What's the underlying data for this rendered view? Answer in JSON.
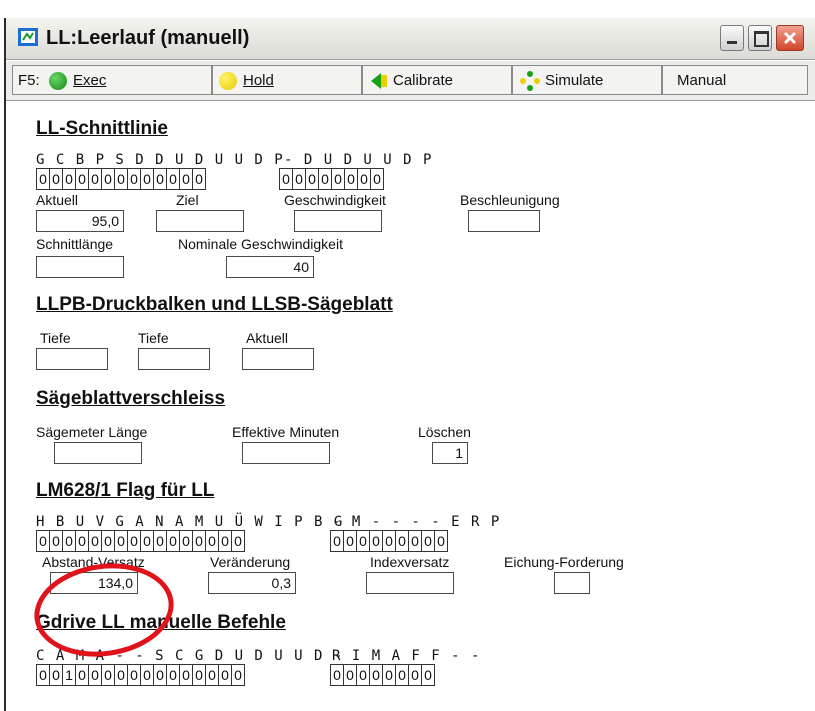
{
  "window": {
    "title": "LL:Leerlauf (manuell)",
    "titlebar_color": "#dcdcd6",
    "close_color": "#d2462a"
  },
  "toolbar": {
    "fkey": "F5:",
    "exec_label": "Exec",
    "hold_label": "Hold",
    "calibrate_label": "Calibrate",
    "simulate_label": "Simulate",
    "manual_label": "Manual"
  },
  "ll_schnittlinie": {
    "title": "LL-Schnittlinie",
    "flags_a": "G C B P S D D U D U U D P",
    "flags_b": "- D U D U U D P",
    "bits_a": [
      "0",
      "0",
      "0",
      "0",
      "0",
      "0",
      "0",
      "0",
      "0",
      "0",
      "0",
      "0",
      "0"
    ],
    "bits_b": [
      "0",
      "0",
      "0",
      "0",
      "0",
      "0",
      "0",
      "0"
    ],
    "aktuell_label": "Aktuell",
    "aktuell_value": "95,0",
    "ziel_label": "Ziel",
    "ziel_value": "",
    "geschwindigkeit_label": "Geschwindigkeit",
    "geschwindigkeit_value": "",
    "beschleunigung_label": "Beschleunigung",
    "beschleunigung_value": "",
    "schnittlaenge_label": "Schnittlänge",
    "schnittlaenge_value": "",
    "nominale_label": "Nominale Geschwindigkeit",
    "nominale_value": "40"
  },
  "llpb": {
    "title": "LLPB-Druckbalken und LLSB-Sägeblatt",
    "tiefe1_label": "Tiefe",
    "tiefe2_label": "Tiefe",
    "aktuell_label": "Aktuell",
    "tiefe1_value": "",
    "tiefe2_value": "",
    "aktuell_value": ""
  },
  "saegeblatt": {
    "title": "Sägeblattverschleiss",
    "saegemeter_label": "Sägemeter Länge",
    "saegemeter_value": "",
    "effektive_label": "Effektive Minuten",
    "effektive_value": "",
    "loeschen_label": "Löschen",
    "loeschen_value": "1"
  },
  "lm628": {
    "title": "LM628/1 Flag für LL",
    "flags_a": "H B U V G A N A M U Ü W I P B G",
    "flags_b": "- M - - - - E R P",
    "bits_a": [
      "0",
      "0",
      "0",
      "0",
      "0",
      "0",
      "0",
      "0",
      "0",
      "0",
      "0",
      "0",
      "0",
      "0",
      "0",
      "0"
    ],
    "bits_b": [
      "0",
      "0",
      "0",
      "0",
      "0",
      "0",
      "0",
      "0",
      "0"
    ],
    "abstand_label": "Abstand-Versatz",
    "abstand_value": "134,0",
    "veraenderung_label": "Veränderung",
    "veraenderung_value": "0,3",
    "indexversatz_label": "Indexversatz",
    "indexversatz_value": "",
    "eichung_label": "Eichung-Forderung",
    "eichung_value": ""
  },
  "gdrive": {
    "title": "Gdrive LL manuelle Befehle",
    "flags_a": "C A M A - - S C G D U D U U D -",
    "flags_b": "R I M A F F - -",
    "bits_a": [
      "0",
      "0",
      "1",
      "0",
      "0",
      "0",
      "0",
      "0",
      "0",
      "0",
      "0",
      "0",
      "0",
      "0",
      "0",
      "0"
    ],
    "bits_b": [
      "0",
      "0",
      "0",
      "0",
      "0",
      "0",
      "0",
      "0"
    ]
  },
  "annotation": {
    "color": "#e0131b"
  }
}
